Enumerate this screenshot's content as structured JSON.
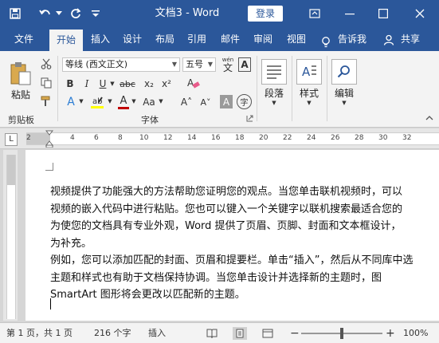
{
  "titlebar": {
    "title": "文档3 - Word",
    "login_label": "登录",
    "icons": [
      "save-icon",
      "undo-icon",
      "redo-icon",
      "customize-icon",
      "ribbon-options-icon",
      "minimize-icon",
      "maximize-icon",
      "close-icon"
    ]
  },
  "tabs": [
    {
      "label": "文件"
    },
    {
      "label": "开始"
    },
    {
      "label": "插入"
    },
    {
      "label": "设计"
    },
    {
      "label": "布局"
    },
    {
      "label": "引用"
    },
    {
      "label": "邮件"
    },
    {
      "label": "审阅"
    },
    {
      "label": "视图"
    },
    {
      "label": "告诉我"
    },
    {
      "label": "共享"
    }
  ],
  "ribbon": {
    "paste_label": "粘贴",
    "clipboard_label": "剪贴板",
    "font_label": "字体",
    "font_name": "等线 (西文正文)",
    "font_size": "五号",
    "wen": "wén",
    "paragraph_label": "段落",
    "styles_label": "样式",
    "editing_label": "编辑",
    "bold": "B",
    "italic": "I",
    "underline": "U",
    "strike": "abc",
    "sub": "x₂",
    "sup": "x²",
    "text_effects": "A",
    "highlight": "A",
    "font_color": "A",
    "aa": "Aa",
    "grow": "A˄",
    "shrink": "A˅",
    "char_shade": "A",
    "enclose": "字",
    "clear_fmt": "A"
  },
  "ruler": {
    "tab_marker": "L",
    "numbers": [
      "2",
      "2",
      "4",
      "6",
      "8",
      "10",
      "12",
      "14",
      "16",
      "18",
      "20",
      "22",
      "24",
      "26",
      "28",
      "30",
      "32"
    ]
  },
  "document": {
    "lines": [
      "视频提供了功能强大的方法帮助您证明您的观点。当您单击联机视频时，可以",
      "视频的嵌入代码中进行粘贴。您也可以键入一个关键字以联机搜索最适合您的",
      "为使您的文档具有专业外观，Word 提供了页眉、页脚、封面和文本框设计，",
      "为补充。",
      "例如，您可以添加匹配的封面、页眉和提要栏。单击“插入”，然后从不同库中选",
      "主题和样式也有助于文档保持协调。当您单击设计并选择新的主题时，图",
      "SmartArt 图形将会更改以匹配新的主题。"
    ]
  },
  "status": {
    "page": "第 1 页，共 1 页",
    "words": "216 个字",
    "mode": "插入",
    "zoom": "100%",
    "zoom_minus": "−",
    "zoom_plus": "+"
  },
  "colors": {
    "titlebar": "#2b579a",
    "ribbon": "#f3f3f3"
  }
}
